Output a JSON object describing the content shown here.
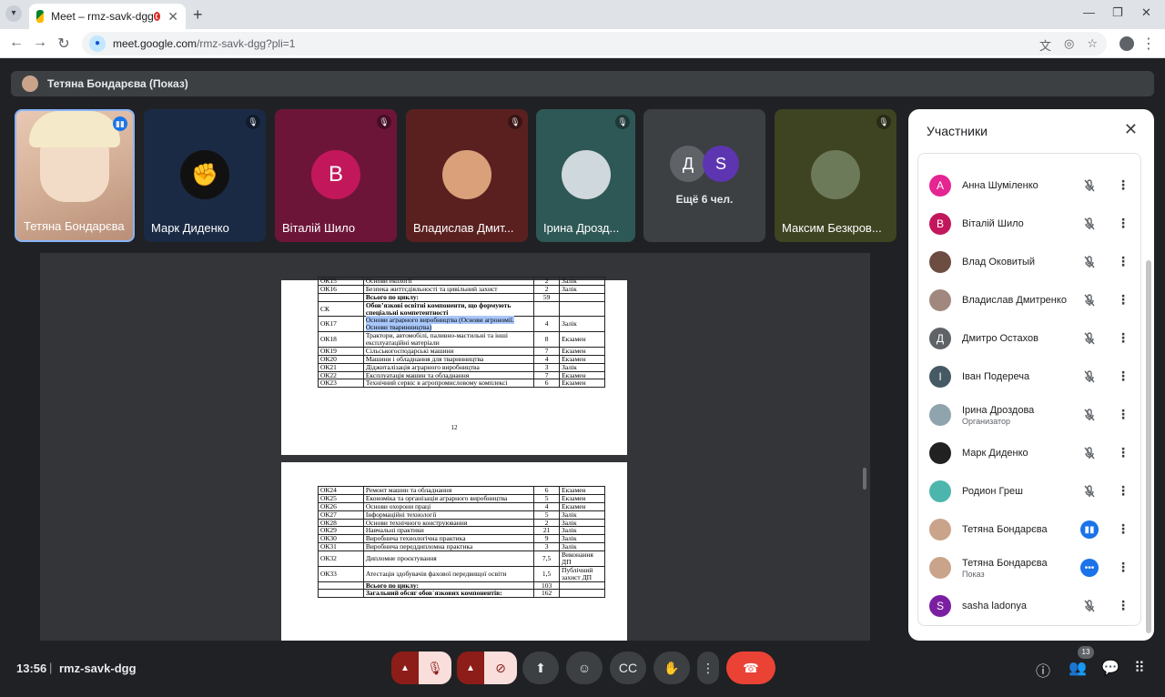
{
  "browser": {
    "tab_title": "Meet – rmz-savk-dgg",
    "url_host": "meet.google.com",
    "url_path": "/rmz-savk-dgg?pli=1"
  },
  "presenter": {
    "label": "Тетяна Бондарєва (Показ)"
  },
  "tiles": [
    {
      "name": "Тетяна Бондарєва",
      "mic": "speaking"
    },
    {
      "name": "Марк Диденко",
      "mic": "muted"
    },
    {
      "name": "Віталій Шило",
      "mic": "muted",
      "initial": "В",
      "color": "#c2185b"
    },
    {
      "name": "Владислав Дмит...",
      "mic": "muted"
    },
    {
      "name": "Ірина Дрозд...",
      "mic": "muted"
    },
    {
      "more_initials": [
        "Д",
        "S"
      ],
      "more_label": "Ещё 6 чел."
    },
    {
      "name": "Максим Безкров...",
      "mic": "muted"
    }
  ],
  "document": {
    "page1_rows": [
      [
        "ОК15",
        "Основи екології",
        "2",
        "Залік"
      ],
      [
        "ОК16",
        "Безпека життєдіяльності та цивільний захист",
        "2",
        "Залік"
      ],
      [
        "",
        "Всього по циклу:",
        "59",
        ""
      ],
      [
        "СК",
        "Обов’язкові освітні компоненти, що формують спеціальні компетентності",
        "",
        ""
      ],
      [
        "ОК17",
        "Основи аграрного виробництва (Основи агрономії. Основи тваринництва)",
        "4",
        "Залік"
      ],
      [
        "ОК18",
        "Трактори, автомобілі, паливно-мастильні та інші експлуатаційні матеріали",
        "8",
        "Екзамен"
      ],
      [
        "ОК19",
        "Сільськогосподарські машини",
        "7",
        "Екзамен"
      ],
      [
        "ОК20",
        "Машини і обладнання для тваринництва",
        "4",
        "Екзамен"
      ],
      [
        "ОК21",
        "Діджиталізація аграрного виробництва",
        "3",
        "Залік"
      ],
      [
        "ОК22",
        "Експлуатація машин та обладнання",
        "7",
        "Екзамен"
      ],
      [
        "ОК23",
        "Технічний сервіс в агропромисловому комплексі",
        "6",
        "Екзамен"
      ]
    ],
    "page_number": "12",
    "page2_rows": [
      [
        "ОК24",
        "Ремонт машин та обладнання",
        "6",
        "Екзамен"
      ],
      [
        "ОК25",
        "Економіка та організація аграрного виробництва",
        "5",
        "Екзамен"
      ],
      [
        "ОК26",
        "Основи охорони праці",
        "4",
        "Екзамен"
      ],
      [
        "ОК27",
        "Інформаційні технології",
        "5",
        "Залік"
      ],
      [
        "ОК28",
        "Основи технічного конструювання",
        "2",
        "Залік"
      ],
      [
        "ОК29",
        "Навчальні практики",
        "21",
        "Залік"
      ],
      [
        "ОК30",
        "Виробнича технологічна практика",
        "9",
        "Залік"
      ],
      [
        "ОК31",
        "Виробнича переддипломна практика",
        "3",
        "Залік"
      ],
      [
        "ОК32",
        "Дипломне проєктування",
        "7,5",
        "Виконання ДП"
      ],
      [
        "ОК33",
        "Атестація здобувачів фахової передвищої освіти",
        "1,5",
        "Публічний захист ДП"
      ],
      [
        "",
        "Всього по циклу:",
        "103",
        ""
      ],
      [
        "",
        "Загальний обсяг обов`язкових компонентів:",
        "162",
        ""
      ]
    ]
  },
  "panel": {
    "title": "Участники",
    "participants": [
      {
        "name": "Анна Шуміленко",
        "initial": "А",
        "color": "#e52592",
        "status": "muted"
      },
      {
        "name": "Віталій Шило",
        "initial": "В",
        "color": "#c2185b",
        "status": "muted"
      },
      {
        "name": "Влад Оковитый",
        "initial": "",
        "color": "#6d4c41",
        "status": "muted"
      },
      {
        "name": "Владислав Дмитренко",
        "initial": "",
        "color": "#a1887f",
        "status": "muted"
      },
      {
        "name": "Дмитро Остахов",
        "initial": "Д",
        "color": "#5f6368",
        "status": "muted"
      },
      {
        "name": "Іван Подереча",
        "initial": "І",
        "color": "#455a64",
        "status": "muted"
      },
      {
        "name": "Ірина Дроздова",
        "sub": "Организатор",
        "initial": "",
        "color": "#90a4ae",
        "status": "muted"
      },
      {
        "name": "Марк Диденко",
        "initial": "",
        "color": "#212121",
        "status": "muted"
      },
      {
        "name": "Родион Греш",
        "initial": "",
        "color": "#4db6ac",
        "status": "muted"
      },
      {
        "name": "Тетяна Бондарєва",
        "initial": "",
        "color": "#c9a48a",
        "status": "speaking"
      },
      {
        "name": "Тетяна Бондарєва",
        "sub": "Показ",
        "initial": "",
        "color": "#c9a48a",
        "status": "presenting"
      },
      {
        "name": "sasha ladonya",
        "initial": "S",
        "color": "#7b1fa2",
        "status": "muted"
      }
    ]
  },
  "bottom": {
    "time": "13:56",
    "separator": "|",
    "meeting_code": "rmz-savk-dgg",
    "participants_count": "13"
  }
}
